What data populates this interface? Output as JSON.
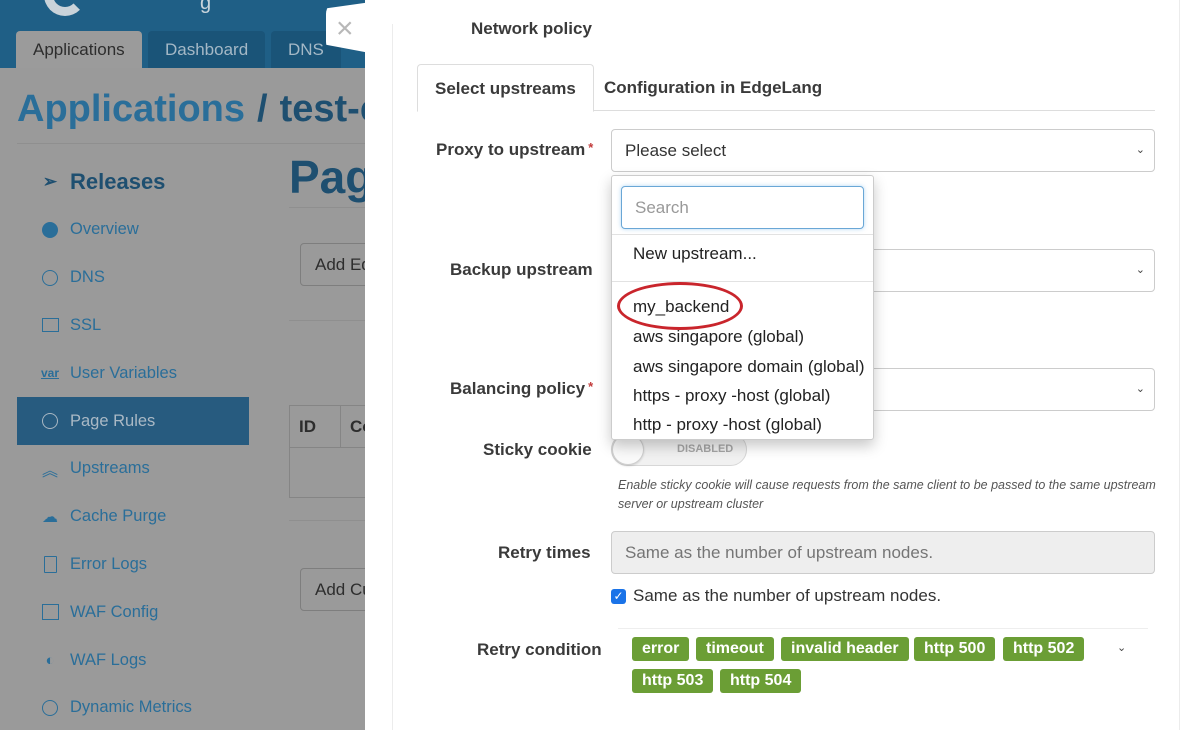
{
  "background": {
    "logo_text": "g",
    "nav_tabs": [
      {
        "label": "Applications",
        "active": true
      },
      {
        "label": "Dashboard",
        "active": false
      },
      {
        "label": "DNS",
        "active": false
      }
    ],
    "breadcrumb": {
      "root": "Applications",
      "separator": "/",
      "current": "test-ec"
    },
    "page_title": "Pag",
    "buttons": {
      "add_edge": "Add Ed",
      "add_custom": "Add Cu"
    },
    "table_headers": [
      "ID",
      "Co"
    ],
    "sidebar": {
      "title": "Releases",
      "items": [
        {
          "label": "Overview",
          "icon": "overview-icon",
          "active": false
        },
        {
          "label": "DNS",
          "icon": "dns-icon",
          "active": false
        },
        {
          "label": "SSL",
          "icon": "ssl-icon",
          "active": false
        },
        {
          "label": "User Variables",
          "icon": "var-icon",
          "active": false
        },
        {
          "label": "Page Rules",
          "icon": "page-rules-icon",
          "active": true
        },
        {
          "label": "Upstreams",
          "icon": "upstreams-icon",
          "active": false
        },
        {
          "label": "Cache Purge",
          "icon": "cloud-icon",
          "active": false
        },
        {
          "label": "Error Logs",
          "icon": "error-log-icon",
          "active": false
        },
        {
          "label": "WAF Config",
          "icon": "list-icon",
          "active": false
        },
        {
          "label": "WAF Logs",
          "icon": "waf-logs-icon",
          "active": false
        },
        {
          "label": "Dynamic Metrics",
          "icon": "metrics-icon",
          "active": false
        }
      ]
    }
  },
  "drawer": {
    "close_icon": "×",
    "section_label": "Network policy",
    "tabs": [
      {
        "label": "Select upstreams",
        "active": true
      },
      {
        "label": "Configuration in EdgeLang",
        "active": false
      }
    ],
    "proxy_to_upstream": {
      "label": "Proxy to upstream",
      "required": "*",
      "value": "Please select"
    },
    "backup_upstream": {
      "label": "Backup upstream",
      "value": ""
    },
    "balancing_policy": {
      "label": "Balancing policy",
      "required": "*",
      "value": ""
    },
    "dropdown": {
      "search_placeholder": "Search",
      "new_item": "New upstream...",
      "options": [
        "my_backend",
        "aws singapore (global)",
        "aws singapore domain (global)",
        "https - proxy -host (global)",
        "http - proxy -host (global)"
      ],
      "highlighted_option": "my_backend"
    },
    "sticky_cookie": {
      "label": "Sticky cookie",
      "state": "DISABLED",
      "help": "Enable sticky cookie will cause requests from the same client to be passed to the same upstream server or upstream cluster"
    },
    "retry_times": {
      "label": "Retry times",
      "placeholder": "Same as the number of upstream nodes.",
      "checkbox_label": "Same as the number of upstream nodes.",
      "checked": true
    },
    "retry_condition": {
      "label": "Retry condition",
      "tags": [
        "error",
        "timeout",
        "invalid header",
        "http 500",
        "http 502",
        "http 503",
        "http 504"
      ],
      "tag_color": "#6b9e35"
    },
    "chevron": "⌄",
    "check": "✓"
  }
}
